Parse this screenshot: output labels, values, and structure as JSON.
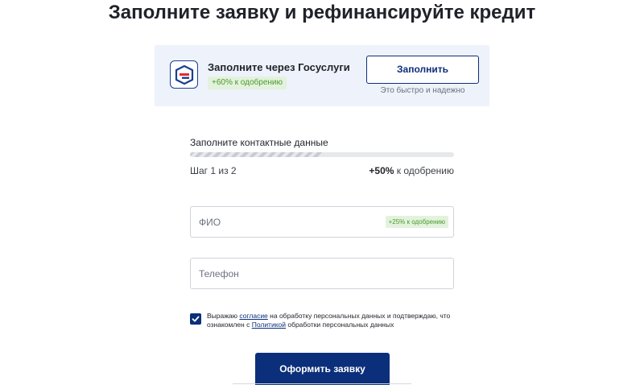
{
  "page": {
    "title": "Заполните заявку и рефинансируйте кредит"
  },
  "gosuslugi": {
    "logo_icon": "gosuslugi-logo-icon",
    "title": "Заполните через Госуслуги",
    "badge": "+60% к одобрению",
    "button_label": "Заполнить",
    "hint": "Это быстро и надежно"
  },
  "progress": {
    "label": "Заполните контактные данные",
    "percent": 50,
    "step_text": "Шаг 1 из 2",
    "bonus_value": "+50%",
    "bonus_text": " к одобрению"
  },
  "fields": {
    "name": {
      "placeholder": "ФИО",
      "value": "",
      "badge": "+25% к одобрению"
    },
    "phone": {
      "placeholder": "Телефон",
      "value": ""
    }
  },
  "consent": {
    "checked": true,
    "check_icon": "checkmark-icon",
    "text_1": "Выражаю ",
    "link_1": "согласие",
    "text_2": " на обработку персональных данных и подтверждаю, что ознакомлен с ",
    "link_2": "Политикой",
    "text_3": " обработки персональных данных"
  },
  "submit": {
    "label": "Оформить заявку"
  },
  "colors": {
    "primary": "#0b2f7a",
    "badge_bg": "#e3f2dc",
    "badge_text": "#4a9a2f",
    "card_bg": "#eef2fa",
    "gos_red": "#e42d2d"
  }
}
